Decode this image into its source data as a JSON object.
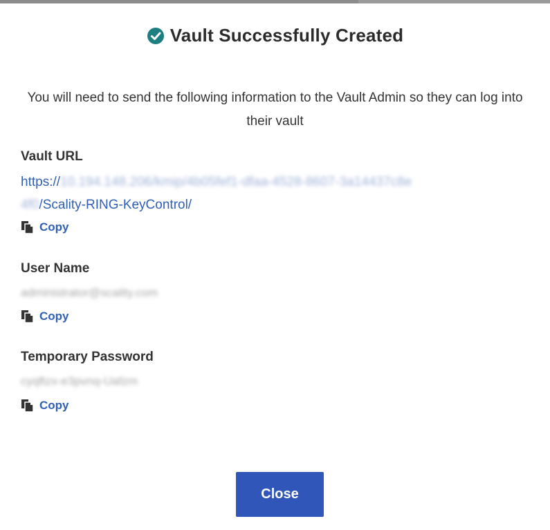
{
  "dialog": {
    "title": "Vault Successfully Created",
    "intro": "You will need to send the following information to the Vault Admin so they can log into their vault",
    "vault_url": {
      "label": "Vault URL",
      "prefix": "https://",
      "obscured_part_1": "10.194.148.206/kmip/4b05fef1-dfaa-4528-8607-3a14437c8e",
      "obscured_part_2": "4f0",
      "suffix": "/Scality-RING-KeyControl/",
      "copy_label": "Copy"
    },
    "user_name": {
      "label": "User Name",
      "value": "administrator@scality.com",
      "copy_label": "Copy"
    },
    "temporary_password": {
      "label": "Temporary Password",
      "value": "cyqftzx-e3pvnq-Uafzm",
      "copy_label": "Copy"
    },
    "close_label": "Close"
  },
  "colors": {
    "accent": "#2f56b8",
    "link": "#2f5fb5",
    "success_icon": "#1e7f80",
    "text": "#333333"
  },
  "icons": {
    "title_icon": "check-circle-icon",
    "copy_icon": "copy-icon"
  }
}
